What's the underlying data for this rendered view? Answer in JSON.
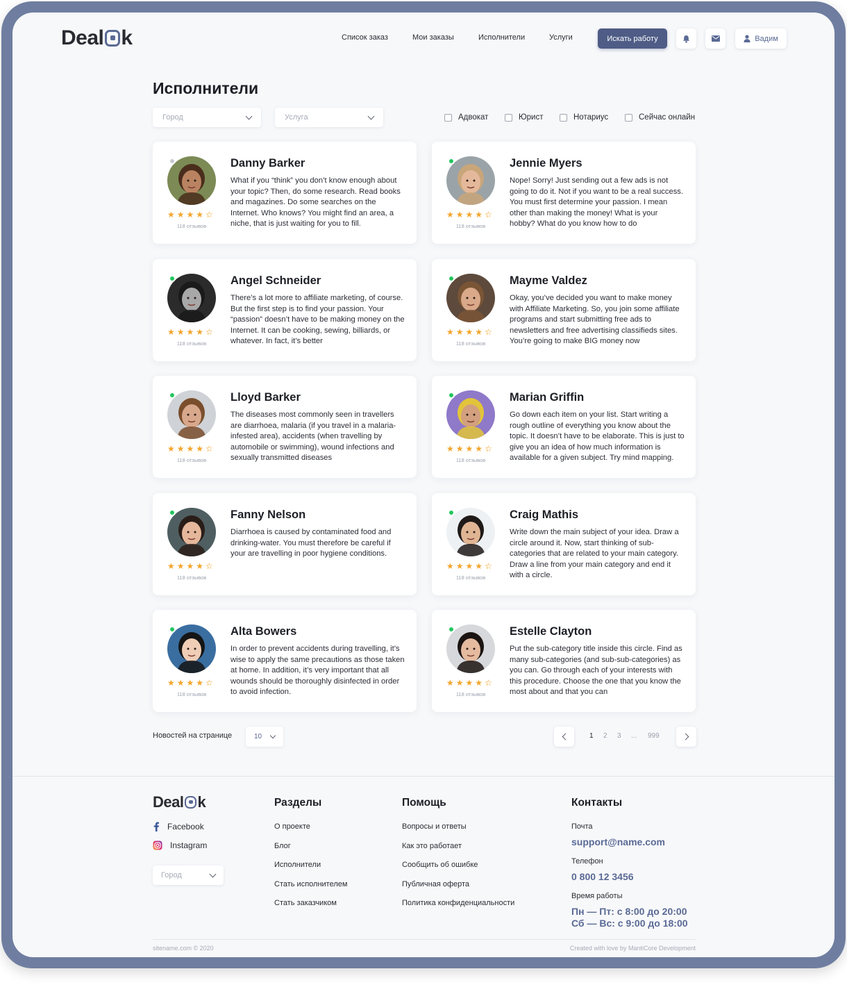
{
  "header": {
    "logo_left": "Deal",
    "logo_right": "k",
    "nav": [
      "Список заказ",
      "Мои заказы",
      "Исполнители",
      "Услуги"
    ],
    "find_work": "Искать работу",
    "user_name": "Вадим"
  },
  "page": {
    "title": "Исполнители",
    "filters": {
      "city_placeholder": "Город",
      "service_placeholder": "Услуга",
      "checks": [
        "Адвокат",
        "Юрист",
        "Нотариус",
        "Сейчас онлайн"
      ]
    }
  },
  "cards": [
    {
      "name": "Danny Barker",
      "online": false,
      "reviews": "118 отзывов",
      "rating": 4.5,
      "skin": "#b98361",
      "hair": "#4a2d1c",
      "bg": "#7c8a55",
      "text": "What if you “think” you don’t know enough about your topic? Then, do some research. Read books and magazines. Do some searches on the Internet. Who knows? You might find an area, a niche, that is just waiting for you to fill."
    },
    {
      "name": "Jennie Myers",
      "online": true,
      "reviews": "118 отзывов",
      "rating": 4.5,
      "skin": "#e4b89a",
      "hair": "#c8a67a",
      "bg": "#9aa3a8",
      "text": "Nope! Sorry! Just sending out a few ads is not going to do it. Not if you want to be a real success. You must first determine your passion. I mean other than making the money! What is your hobby? What do you know how to do"
    },
    {
      "name": "Angel Schneider",
      "online": true,
      "reviews": "118 отзывов",
      "rating": 4.5,
      "skin": "#a8a8a8",
      "hair": "#1a1a1a",
      "bg": "#2b2b2b",
      "text": "There’s a lot more to affiliate marketing, of course. But the first step is to find your passion. Your “passion” doesn’t have to be making money on the Internet. It can be cooking, sewing, billiards, or whatever. In fact, it’s better"
    },
    {
      "name": "Mayme Valdez",
      "online": true,
      "reviews": "118 отзывов",
      "rating": 4.5,
      "skin": "#d9a98a",
      "hair": "#7a5535",
      "bg": "#5e4a3c",
      "text": "Okay, you’ve decided you want to make money with Affiliate Marketing. So, you join some affiliate programs and start submitting free ads to newsletters and free advertising classifieds sites. You’re going to make BIG money now"
    },
    {
      "name": "Lloyd Barker",
      "online": true,
      "reviews": "118 отзывов",
      "rating": 4.5,
      "skin": "#d8a88c",
      "hair": "#7a4e2c",
      "bg": "#cfd2d6",
      "text": "The diseases most commonly seen in travellers are diarrhoea, malaria (if you travel in a malaria-infested area), accidents (when travelling by automobile or swimming), wound infections and sexually transmitted diseases"
    },
    {
      "name": "Marian Griffin",
      "online": true,
      "reviews": "118 отзывов",
      "rating": 4.5,
      "skin": "#d2a07e",
      "hair": "#e2c43a",
      "bg": "#8f79c9",
      "text": "Go down each item on your list. Start writing a rough outline of everything you know about the topic. It doesn’t have to be elaborate. This is just to give you an idea of how much information is available for a given subject. Try mind mapping."
    },
    {
      "name": "Fanny Nelson",
      "online": true,
      "reviews": "118 отзывов",
      "rating": 4.5,
      "skin": "#e5b79b",
      "hair": "#2a1d18",
      "bg": "#4f5f61",
      "text": "Diarrhoea is caused by contaminated food and drinking-water. You must therefore be careful if your are travelling in poor hygiene conditions."
    },
    {
      "name": "Craig Mathis",
      "online": true,
      "reviews": "118 отзывов",
      "rating": 4.5,
      "skin": "#e0b594",
      "hair": "#1f1a18",
      "bg": "#eef1f4",
      "text": "Write down the main subject of your idea. Draw a circle around it. Now, start thinking of sub-categories that are related to your main category. Draw a line from your main category and end it with a circle."
    },
    {
      "name": "Alta Bowers",
      "online": true,
      "reviews": "118 отзывов",
      "rating": 4.5,
      "skin": "#efcdb6",
      "hair": "#151515",
      "bg": "#3a6ea0",
      "text": "In order to prevent accidents during travelling, it’s wise to apply the same precautions as those taken at home. In addition, it’s very important that all wounds should be thoroughly disinfected in order to avoid infection."
    },
    {
      "name": "Estelle Clayton",
      "online": true,
      "reviews": "118 отзывов",
      "rating": 4.5,
      "skin": "#e5bba0",
      "hair": "#1b1412",
      "bg": "#d6d8db",
      "text": "Put the sub-category title inside this circle. Find as many sub-categories (and sub-sub-categories) as you can. Go through each of your interests with this procedure. Choose the one that you know the most about and that you can"
    }
  ],
  "pagination": {
    "per_page_label": "Новостей на странице",
    "per_page_value": "10",
    "pages": [
      "1",
      "2",
      "3",
      "...",
      "999"
    ]
  },
  "footer": {
    "sections_title": "Разделы",
    "sections": [
      "О проекте",
      "Блог",
      "Исполнители",
      "Стать исполнителем",
      "Стать заказчиком"
    ],
    "help_title": "Помощь",
    "help": [
      "Вопросы и ответы",
      "Как это работает",
      "Сообщить об ошибке",
      "Публичная оферта",
      "Политика конфиденциальности"
    ],
    "contacts_title": "Контакты",
    "mail_label": "Почта",
    "mail": "support@name.com",
    "phone_label": "Телефон",
    "phone": "0 800 12 3456",
    "hours_label": "Время работы",
    "hours_1": "Пн — Пт: с 8:00 до 20:00",
    "hours_2": "Сб — Вс: с 9:00 до 18:00",
    "facebook": "Facebook",
    "instagram": "Instagram",
    "city_placeholder": "Город",
    "copyright": "sitename.com © 2020",
    "credits": "Created with love by MantiCore Development"
  },
  "colors": {
    "accent": "#4e5c86",
    "star": "#f4a52b",
    "online": "#23c55e"
  }
}
